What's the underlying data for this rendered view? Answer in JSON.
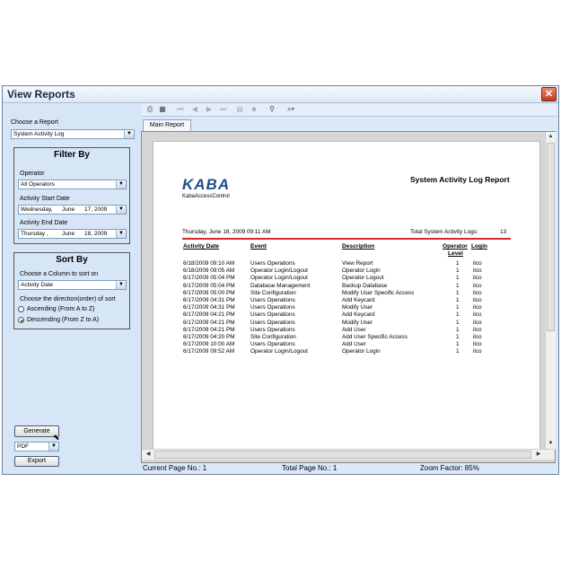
{
  "window": {
    "title": "View Reports"
  },
  "left_panel": {
    "choose_report_label": "Choose a Report",
    "report_value": "System Activity Log",
    "filter_by": {
      "title": "Filter By",
      "operator_label": "Operator",
      "operator_value": "All Operators",
      "start_label": "Activity Start Date",
      "start_day": "Wednesday,",
      "start_month": "June",
      "start_date": "17, 2009",
      "end_label": "Activity End Date",
      "end_day": "Thursday  ,",
      "end_month": "June",
      "end_date": "18, 2009"
    },
    "sort_by": {
      "title": "Sort By",
      "column_label": "Choose a Column to sort on",
      "column_value": "Activity Date",
      "direction_label": "Choose the direction(order) of sort",
      "ascending": "Ascending (From A to Z)",
      "descending": "Descending (From Z to A)"
    },
    "generate_label": "Generate",
    "format_value": "PDF",
    "export_label": "Export"
  },
  "tab": {
    "label": "Main Report"
  },
  "report": {
    "logo": "KABA",
    "logo_sub": "KabaAccessControl",
    "title": "System Activity Log Report",
    "date_line": "Thursday, June 18, 2009 09:11 AM",
    "total_label": "Total System Activity Logs:",
    "total_value": "13",
    "headers": {
      "date": "Activity Date",
      "event": "Event",
      "desc": "Description",
      "level_1": "Operator",
      "level_2": "Level",
      "login": "Login"
    },
    "rows": [
      {
        "date": "6/18/2009  09:10 AM",
        "event": "Users Operations",
        "desc": "View Report",
        "level": "1",
        "login": "ilco"
      },
      {
        "date": "6/18/2009  09:05 AM",
        "event": "Operator Login/Logout",
        "desc": "Operator Login",
        "level": "1",
        "login": "ilco"
      },
      {
        "date": "6/17/2009  05:04 PM",
        "event": "Operator Login/Logout",
        "desc": "Operator Logout",
        "level": "1",
        "login": "ilco"
      },
      {
        "date": "6/17/2009  05:04 PM",
        "event": "Database Management",
        "desc": "Backup Database",
        "level": "1",
        "login": "ilco"
      },
      {
        "date": "6/17/2009  05:00 PM",
        "event": "Site Configuration",
        "desc": "Modify User Specific Access",
        "level": "1",
        "login": "ilco"
      },
      {
        "date": "6/17/2009  04:31 PM",
        "event": "Users Operations",
        "desc": "Add Keycard",
        "level": "1",
        "login": "ilco"
      },
      {
        "date": "6/17/2009  04:31 PM",
        "event": "Users Operations",
        "desc": "Modify User",
        "level": "1",
        "login": "ilco"
      },
      {
        "date": "6/17/2009  04:21 PM",
        "event": "Users Operations",
        "desc": "Add Keycard",
        "level": "1",
        "login": "ilco"
      },
      {
        "date": "6/17/2009  04:21 PM",
        "event": "Users Operations",
        "desc": "Modify User",
        "level": "1",
        "login": "ilco"
      },
      {
        "date": "6/17/2009  04:21 PM",
        "event": "Users Operations",
        "desc": "Add User",
        "level": "1",
        "login": "ilco"
      },
      {
        "date": "6/17/2009  04:20 PM",
        "event": "Site Configuration",
        "desc": "Add User Specific Access",
        "level": "1",
        "login": "ilco"
      },
      {
        "date": "6/17/2009  10:00 AM",
        "event": "Users Operations",
        "desc": "Add User",
        "level": "1",
        "login": "ilco"
      },
      {
        "date": "6/17/2009  09:52 AM",
        "event": "Operator Login/Logout",
        "desc": "Operator Login",
        "level": "1",
        "login": "ilco"
      }
    ]
  },
  "status": {
    "current_page": "Current Page No.: 1",
    "total_page": "Total Page No.: 1",
    "zoom": "Zoom Factor: 85%"
  },
  "colors": {
    "accent_red": "#d62a2a",
    "kaba_blue": "#1d4f8f"
  }
}
